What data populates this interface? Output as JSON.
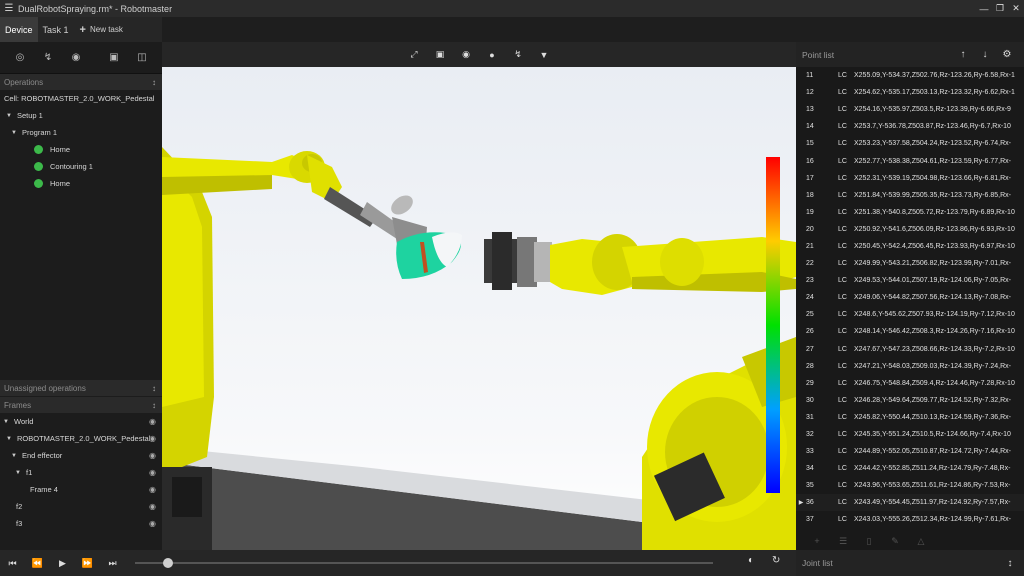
{
  "titlebar": {
    "title": "DualRobotSpraying.rm* - Robotmaster",
    "menu_icon": "hamburger-icon",
    "controls": [
      "minimize-icon",
      "restore-icon",
      "close-icon"
    ]
  },
  "tabs": {
    "device": "Device",
    "task1": "Task 1",
    "new_task": "New task"
  },
  "operations": {
    "header": "Operations",
    "cell": "Cell: ROBOTMASTER_2.0_WORK_Pedestal",
    "setup": "Setup 1",
    "program": "Program 1",
    "items": [
      "Home",
      "Contouring 1",
      "Home"
    ]
  },
  "unassigned": {
    "header": "Unassigned operations"
  },
  "frames": {
    "header": "Frames",
    "world": "World",
    "pedestal": "ROBOTMASTER_2.0_WORK_Pedestal",
    "end_effector": "End effector",
    "f1": "f1",
    "frame4": "Frame 4",
    "f2": "f2",
    "f3": "f3"
  },
  "pointlist": {
    "header": "Point list",
    "selected": "36",
    "rows": [
      {
        "n": "11",
        "t": "LC",
        "c": "X255.09,Y-534.37,Z502.76,Rz-123.26,Ry-6.58,Rx-1"
      },
      {
        "n": "12",
        "t": "LC",
        "c": "X254.62,Y-535.17,Z503.13,Rz-123.32,Ry-6.62,Rx-1"
      },
      {
        "n": "13",
        "t": "LC",
        "c": "X254.16,Y-535.97,Z503.5,Rz-123.39,Ry-6.66,Rx-9"
      },
      {
        "n": "14",
        "t": "LC",
        "c": "X253.7,Y-536.78,Z503.87,Rz-123.46,Ry-6.7,Rx-10"
      },
      {
        "n": "15",
        "t": "LC",
        "c": "X253.23,Y-537.58,Z504.24,Rz-123.52,Ry-6.74,Rx-"
      },
      {
        "n": "16",
        "t": "LC",
        "c": "X252.77,Y-538.38,Z504.61,Rz-123.59,Ry-6.77,Rx-"
      },
      {
        "n": "17",
        "t": "LC",
        "c": "X252.31,Y-539.19,Z504.98,Rz-123.66,Ry-6.81,Rx-"
      },
      {
        "n": "18",
        "t": "LC",
        "c": "X251.84,Y-539.99,Z505.35,Rz-123.73,Ry-6.85,Rx-"
      },
      {
        "n": "19",
        "t": "LC",
        "c": "X251.38,Y-540.8,Z505.72,Rz-123.79,Ry-6.89,Rx-10"
      },
      {
        "n": "20",
        "t": "LC",
        "c": "X250.92,Y-541.6,Z506.09,Rz-123.86,Ry-6.93,Rx-10"
      },
      {
        "n": "21",
        "t": "LC",
        "c": "X250.45,Y-542.4,Z506.45,Rz-123.93,Ry-6.97,Rx-10"
      },
      {
        "n": "22",
        "t": "LC",
        "c": "X249.99,Y-543.21,Z506.82,Rz-123.99,Ry-7.01,Rx-"
      },
      {
        "n": "23",
        "t": "LC",
        "c": "X249.53,Y-544.01,Z507.19,Rz-124.06,Ry-7.05,Rx-"
      },
      {
        "n": "24",
        "t": "LC",
        "c": "X249.06,Y-544.82,Z507.56,Rz-124.13,Ry-7.08,Rx-"
      },
      {
        "n": "25",
        "t": "LC",
        "c": "X248.6,Y-545.62,Z507.93,Rz-124.19,Ry-7.12,Rx-10"
      },
      {
        "n": "26",
        "t": "LC",
        "c": "X248.14,Y-546.42,Z508.3,Rz-124.26,Ry-7.16,Rx-10"
      },
      {
        "n": "27",
        "t": "LC",
        "c": "X247.67,Y-547.23,Z508.66,Rz-124.33,Ry-7.2,Rx-10"
      },
      {
        "n": "28",
        "t": "LC",
        "c": "X247.21,Y-548.03,Z509.03,Rz-124.39,Ry-7.24,Rx-"
      },
      {
        "n": "29",
        "t": "LC",
        "c": "X246.75,Y-548.84,Z509.4,Rz-124.46,Ry-7.28,Rx-10"
      },
      {
        "n": "30",
        "t": "LC",
        "c": "X246.28,Y-549.64,Z509.77,Rz-124.52,Ry-7.32,Rx-"
      },
      {
        "n": "31",
        "t": "LC",
        "c": "X245.82,Y-550.44,Z510.13,Rz-124.59,Ry-7.36,Rx-"
      },
      {
        "n": "32",
        "t": "LC",
        "c": "X245.35,Y-551.24,Z510.5,Rz-124.66,Ry-7.4,Rx-10"
      },
      {
        "n": "33",
        "t": "LC",
        "c": "X244.89,Y-552.05,Z510.87,Rz-124.72,Ry-7.44,Rx-"
      },
      {
        "n": "34",
        "t": "LC",
        "c": "X244.42,Y-552.85,Z511.24,Rz-124.79,Ry-7.48,Rx-"
      },
      {
        "n": "35",
        "t": "LC",
        "c": "X243.96,Y-553.65,Z511.61,Rz-124.86,Ry-7.53,Rx-"
      },
      {
        "n": "36",
        "t": "LC",
        "c": "X243.49,Y-554.45,Z511.97,Rz-124.92,Ry-7.57,Rx-"
      },
      {
        "n": "37",
        "t": "LC",
        "c": "X243.03,Y-555.26,Z512.34,Rz-124.99,Ry-7.61,Rx-"
      }
    ]
  },
  "jointlist": {
    "header": "Joint list"
  },
  "colors": {
    "robot_yellow": "#e6e600",
    "spray_green": "#1ed3a0",
    "selected_green_dot": "#3cb94a"
  }
}
